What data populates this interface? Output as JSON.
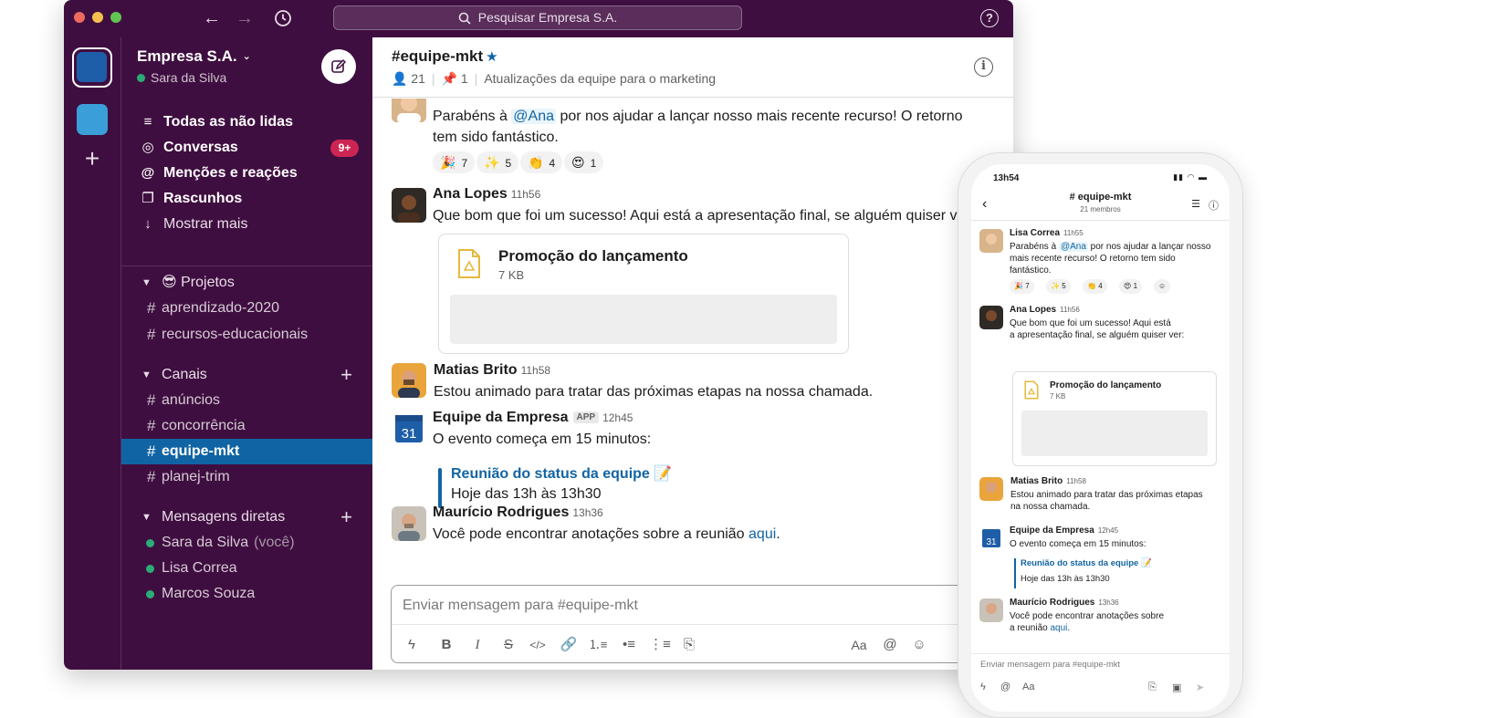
{
  "search": {
    "placeholder": "Pesquisar Empresa S.A."
  },
  "workspace": {
    "name": "Empresa S.A.",
    "user": "Sara da Silva"
  },
  "sidebar": {
    "nav": [
      {
        "label": "Todas as não lidas",
        "icon": "list-icon"
      },
      {
        "label": "Conversas",
        "icon": "threads-icon",
        "badge": "9+"
      },
      {
        "label": "Menções e reações",
        "icon": "at-icon"
      },
      {
        "label": "Rascunhos",
        "icon": "drafts-icon"
      },
      {
        "label": "Mostrar mais",
        "icon": "arrow-down-icon"
      }
    ],
    "projects": {
      "label": "😎 Projetos",
      "channels": [
        "aprendizado-2020",
        "recursos-educacionais"
      ]
    },
    "channels_section": {
      "label": "Canais",
      "channels": [
        "anúncios",
        "concorrência",
        "equipe-mkt",
        "planej-trim"
      ]
    },
    "dms_section": {
      "label": "Mensagens diretas",
      "dms": [
        {
          "name": "Sara da Silva",
          "suffix": "(você)"
        },
        {
          "name": "Lisa Correa"
        },
        {
          "name": "Marcos Souza"
        }
      ]
    }
  },
  "channel": {
    "title": "#equipe-mkt",
    "members": "21",
    "pins": "1",
    "topic": "Atualizações da equipe para o marketing"
  },
  "messages": {
    "m1": {
      "pre": "Parabéns à ",
      "mention": "@Ana",
      "post_line1": " por nos ajudar a lançar nosso mais recente recurso! O retorno",
      "line2": "tem sido fantástico.",
      "reactions": [
        {
          "emoji": "🎉",
          "count": "7"
        },
        {
          "emoji": "✨",
          "count": "5"
        },
        {
          "emoji": "👏",
          "count": "4"
        },
        {
          "emoji": "😍",
          "count": "1"
        }
      ]
    },
    "m2": {
      "name": "Ana Lopes",
      "time": "11h56",
      "text": "Que bom que foi um sucesso! Aqui está a apresentação final, se alguém quiser ver:",
      "file_name": "Promoção do lançamento",
      "file_size": "7 KB"
    },
    "m3": {
      "name": "Matias Brito",
      "time": "11h58",
      "text": "Estou animado para tratar das próximas etapas na nossa chamada."
    },
    "m4": {
      "name": "Equipe da Empresa",
      "badge": "APP",
      "time": "12h45",
      "text": "O evento começa em 15 minutos:",
      "calendar_day": "31",
      "event_title": "Reunião do status da equipe 📝",
      "event_time": "Hoje das 13h às 13h30"
    },
    "m5": {
      "name": "Maurício Rodrigues",
      "time": "13h36",
      "text": "Você pode encontrar anotações sobre a reunião ",
      "link": "aqui",
      "end": "."
    }
  },
  "composer": {
    "placeholder": "Enviar mensagem para #equipe-mkt"
  },
  "phone": {
    "clock": "13h54",
    "title": "# equipe-mkt",
    "members": "21 membros",
    "m1": {
      "name": "Lisa Correa",
      "time": "11h55",
      "pre": "Parabéns à ",
      "mention": "@Ana",
      "post": " por nos ajudar a lançar nosso",
      "line2": "mais recente recurso! O retorno tem sido",
      "line3": "fantástico."
    },
    "m2": {
      "name": "Ana Lopes",
      "time": "11h56",
      "line1": "Que bom que foi um sucesso! Aqui está",
      "line2": "a apresentação final, se alguém quiser ver:"
    },
    "m3": {
      "name": "Matias Brito",
      "time": "11h58",
      "line1": "Estou animado para tratar das próximas etapas",
      "line2": "na nossa chamada."
    },
    "m4": {
      "name": "Equipe da Empresa",
      "time": "12h45",
      "text": "O evento começa em 15 minutos:"
    },
    "m5": {
      "name": "Maurício Rodrigues",
      "time": "13h36",
      "line1": "Você pode encontrar anotações sobre",
      "line2_pre": "a reunião ",
      "link": "aqui",
      "end": "."
    },
    "composer_placeholder": "Enviar mensagem para #equipe-mkt"
  },
  "colors": {
    "sidebar_bg": "#3f0e40",
    "active_channel": "#1164a3",
    "link": "#1264a3",
    "badge": "#cd2553",
    "presence": "#2bac76"
  }
}
